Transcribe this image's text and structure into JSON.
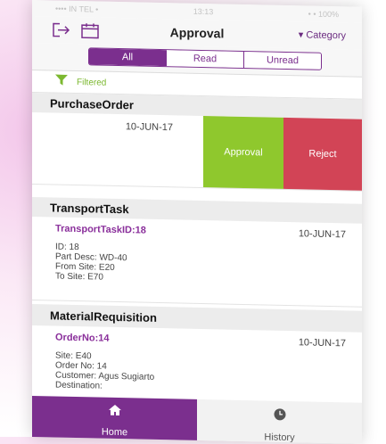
{
  "status": {
    "left": "•••• IN TEL •",
    "center": "13:13",
    "right": "• • 100%"
  },
  "header": {
    "title": "Approval",
    "category_label": "▾ Category"
  },
  "segments": [
    {
      "label": "All",
      "active": true
    },
    {
      "label": "Read",
      "active": false
    },
    {
      "label": "Unread",
      "active": false
    }
  ],
  "filter": {
    "label": "Filtered"
  },
  "sections": {
    "purchase_order": {
      "title": "PurchaseOrder",
      "date": "10-JUN-17",
      "approve_label": "Approval",
      "reject_label": "Reject"
    },
    "transport_task": {
      "title": "TransportTask",
      "item_title": "TransportTaskID:18",
      "date": "10-JUN-17",
      "lines": [
        "ID: 18",
        "Part Desc: WD-40",
        "From Site: E20",
        "To Site: E70"
      ]
    },
    "material_requisition": {
      "title": "MaterialRequisition",
      "item_title": "OrderNo:14",
      "date": "10-JUN-17",
      "lines": [
        "Site: E40",
        "Order No: 14",
        "Customer: Agus Sugiarto",
        "Destination:"
      ]
    }
  },
  "tabs": {
    "home": "Home",
    "history": "History"
  },
  "colors": {
    "accent": "#7b2f8e",
    "approve": "#8fc82d",
    "reject": "#d24456",
    "filter": "#7cb830"
  }
}
